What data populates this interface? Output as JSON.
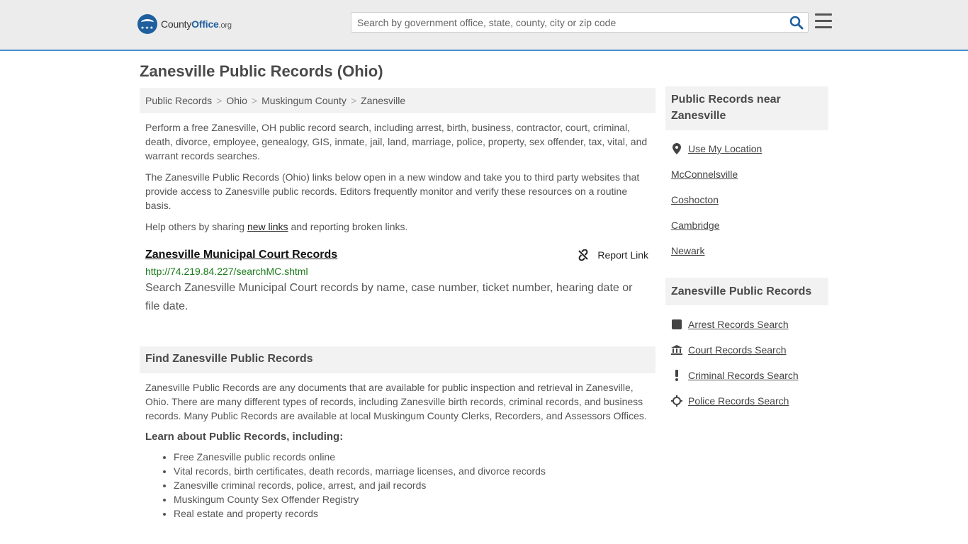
{
  "header": {
    "logo": {
      "part1": "County",
      "part2": "Office",
      "part3": ".org",
      "stars": "★★★"
    },
    "search_placeholder": "Search by government office, state, county, city or zip code"
  },
  "page_title": "Zanesville Public Records (Ohio)",
  "breadcrumb": [
    "Public Records",
    "Ohio",
    "Muskingum County",
    "Zanesville"
  ],
  "intro": {
    "p1": "Perform a free Zanesville, OH public record search, including arrest, birth, business, contractor, court, criminal, death, divorce, employee, genealogy, GIS, inmate, jail, land, marriage, police, property, sex offender, tax, vital, and warrant records searches.",
    "p2": "The Zanesville Public Records (Ohio) links below open in a new window and take you to third party websites that provide access to Zanesville public records. Editors frequently monitor and verify these resources on a routine basis.",
    "p3_before": "Help others by sharing ",
    "p3_link": "new links",
    "p3_after": " and reporting broken links."
  },
  "record": {
    "title": "Zanesville Municipal Court Records",
    "report_label": "Report Link",
    "url": "http://74.219.84.227/searchMC.shtml",
    "description": "Search Zanesville Municipal Court records by name, case number, ticket number, hearing date or file date."
  },
  "find_section": {
    "heading": "Find Zanesville Public Records",
    "body": "Zanesville Public Records are any documents that are available for public inspection and retrieval in Zanesville, Ohio. There are many different types of records, including Zanesville birth records, criminal records, and business records. Many Public Records are available at local Muskingum County Clerks, Recorders, and Assessors Offices.",
    "learn_heading": "Learn about Public Records, including:",
    "items": [
      "Free Zanesville public records online",
      "Vital records, birth certificates, death records, marriage licenses, and divorce records",
      "Zanesville criminal records, police, arrest, and jail records",
      "Muskingum County Sex Offender Registry",
      "Real estate and property records"
    ]
  },
  "sidebar": {
    "near_heading": "Public Records near Zanesville",
    "use_location": "Use My Location",
    "near_links": [
      "McConnelsville",
      "Coshocton",
      "Cambridge",
      "Newark"
    ],
    "records_heading": "Zanesville Public Records",
    "record_links": [
      {
        "label": "Arrest Records Search",
        "icon": "square-icon"
      },
      {
        "label": "Court Records Search",
        "icon": "courthouse-icon"
      },
      {
        "label": "Criminal Records Search",
        "icon": "exclamation-icon"
      },
      {
        "label": "Police Records Search",
        "icon": "crosshair-icon"
      }
    ]
  }
}
